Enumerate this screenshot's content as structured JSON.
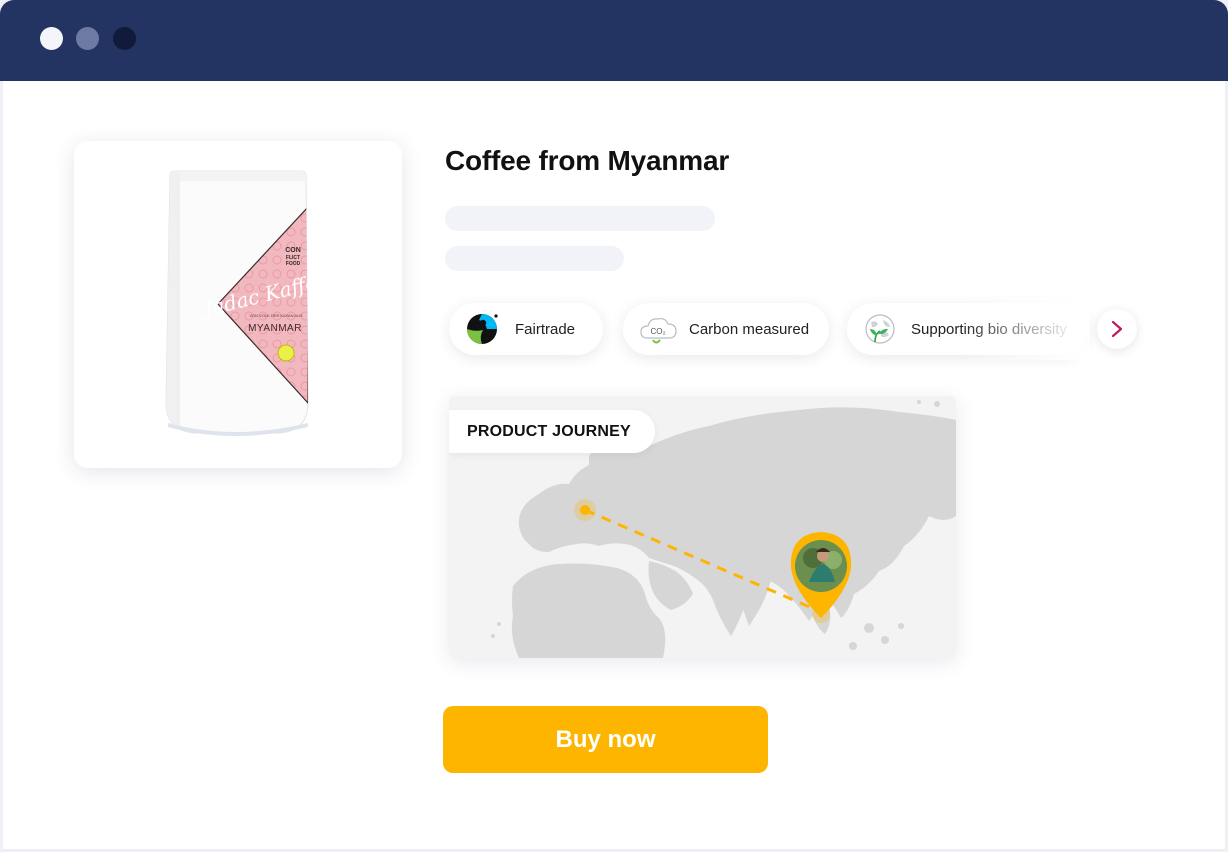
{
  "window": {
    "controls": [
      "close",
      "minimize",
      "maximize"
    ]
  },
  "product": {
    "title": "Coffee from Myanmar",
    "image": {
      "brand_text": [
        "CON",
        "FLICT",
        "FOOD"
      ],
      "script_title": "Jadac Kaffee",
      "subtitle_small": "VON VOLK DER KAYAN AUS",
      "region_text": "MYANMAR",
      "bag_color": "#ffffff",
      "label_color": "#f2b8bf"
    }
  },
  "badges": [
    {
      "label": "Fairtrade",
      "icon": "fairtrade-icon"
    },
    {
      "label": "Carbon measured",
      "icon": "co2-cloud-icon"
    },
    {
      "label": "Supporting bio diversity",
      "icon": "globe-leaf-icon"
    }
  ],
  "badges_next": {
    "icon": "chevron-right-icon"
  },
  "journey": {
    "label": "PRODUCT JOURNEY",
    "route_color": "#fdb500"
  },
  "cta": {
    "label": "Buy now",
    "color": "#fdb500"
  },
  "colors": {
    "titlebar": "#243462",
    "accent": "#fdb500",
    "map_land": "#d6d6d6",
    "chevron": "#c2185b"
  }
}
